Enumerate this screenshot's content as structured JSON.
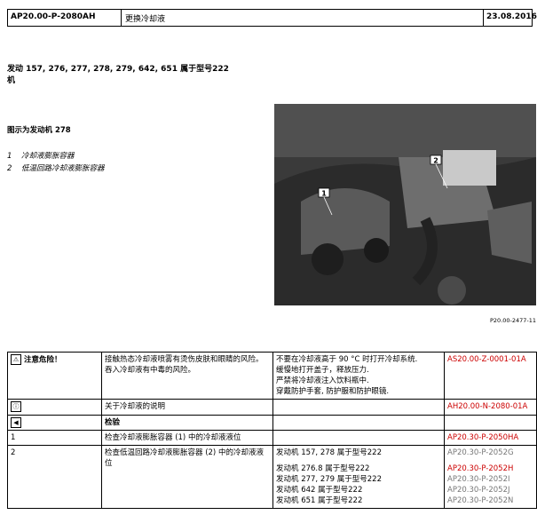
{
  "header": {
    "doc_id": "AP20.00-P-2080AH",
    "title": "更换冷却液",
    "date": "23.08.2016"
  },
  "applicability": {
    "line1": "发动  157, 276, 277, 278, 279, 642, 651 属于型号222",
    "line2": "机"
  },
  "figure": {
    "caption": "图示为发动机 278",
    "legend": [
      {
        "num": "1",
        "text": "冷却液膨胀容器"
      },
      {
        "num": "2",
        "text": "低温回路冷却液膨胀容器"
      }
    ],
    "callouts": [
      "1",
      "2"
    ],
    "ref": "P20.00-2477-11"
  },
  "table": {
    "danger": {
      "label": "注意危险！",
      "desc": "接触热态冷却液喷雾有烫伤皮肤和眼睛的风险。吞入冷却液有中毒的风险。",
      "measures": [
        "不要在冷却液高于 90 °C 时打开冷却系统.",
        "缓慢地打开盖子，释放压力.",
        "严禁将冷却液注入饮料瓶中.",
        "穿戴防护手套, 防护服和防护眼镜."
      ],
      "ref": "AS20.00-Z-0001-01A"
    },
    "info": {
      "desc": "关于冷却液的说明",
      "ref": "AH20.00-N-2080-01A"
    },
    "section": {
      "label": "检验"
    },
    "step1": {
      "num": "1",
      "desc": "检查冷却液膨胀容器 (1) 中的冷却液液位",
      "ref": "AP20.30-P-2050HA"
    },
    "step2": {
      "num": "2",
      "desc": "检查低温回路冷却液膨胀容器 (2) 中的冷却液液位",
      "rows": [
        {
          "engine": "发动机 157, 278 属于型号222",
          "ref": "AP20.30-P-2052G"
        },
        {
          "engine": "发动机 276.8 属于型号222",
          "ref": "AP20.30-P-2052H"
        },
        {
          "engine": "发动机 277, 279 属于型号222",
          "ref": "AP20.30-P-2052I"
        },
        {
          "engine": "发动机 642 属于型号222",
          "ref": "AP20.30-P-2052J"
        },
        {
          "engine": "发动机 651 属于型号222",
          "ref": "AP20.30-P-2052N"
        }
      ]
    }
  }
}
